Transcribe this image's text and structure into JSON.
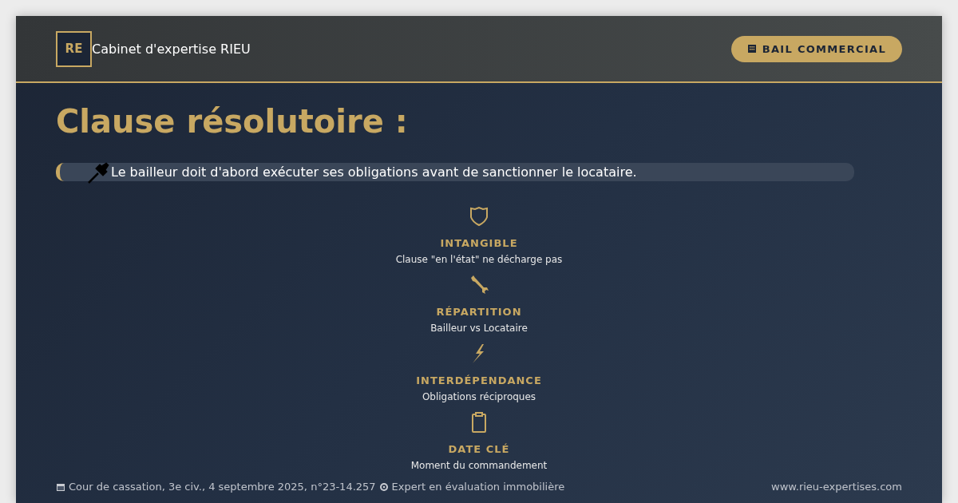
{
  "header": {
    "logo": "RE",
    "company": "Cabinet d'expertise RIEU",
    "badge": "BAIL COMMERCIAL"
  },
  "title": "Clause résolutoire :",
  "callout": "Le bailleur doit d'abord exécuter ses obligations avant de sanctionner le locataire.",
  "features": [
    {
      "title": "INTANGIBLE",
      "description": "Clause \"en l'état\" ne décharge pas"
    },
    {
      "title": "RÉPARTITION",
      "description": "Bailleur vs Locataire"
    },
    {
      "title": "INTERDÉPENDANCE",
      "description": "Obligations réciproques"
    },
    {
      "title": "DATE CLÉ",
      "description": "Moment du commandement"
    }
  ],
  "footer": {
    "citation": "Cour de cassation, 3e civ., 4 septembre 2025, n°23-14.257",
    "tagline": "Expert en évaluation immobilière",
    "website": "www.rieu-expertises.com"
  }
}
